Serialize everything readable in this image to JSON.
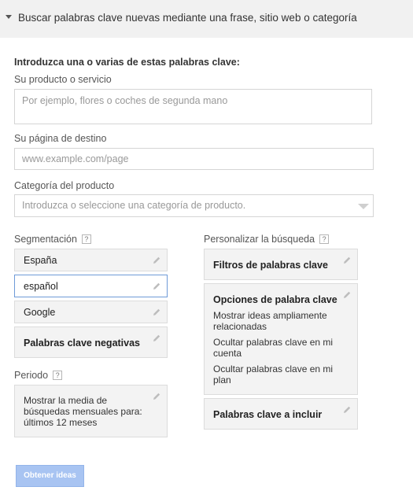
{
  "header": {
    "title": "Buscar palabras clave nuevas mediante una frase, sitio web o categoría"
  },
  "intro": "Introduzca una o varias de estas palabras clave:",
  "product": {
    "label": "Su producto o servicio",
    "placeholder": "Por ejemplo, flores o coches de segunda mano"
  },
  "landing": {
    "label": "Su página de destino",
    "placeholder": "www.example.com/page"
  },
  "category": {
    "label": "Categoría del producto",
    "placeholder": "Introduzca o seleccione una categoría de producto."
  },
  "targeting": {
    "label": "Segmentación",
    "help": "?",
    "items": [
      "España",
      "español",
      "Google"
    ],
    "negative": "Palabras clave negativas"
  },
  "period": {
    "label": "Periodo",
    "help": "?",
    "lines": [
      "Mostrar la media de",
      "búsquedas mensuales para:",
      "últimos 12 meses"
    ]
  },
  "customize": {
    "label": "Personalizar la búsqueda",
    "help": "?",
    "filters": "Filtros de palabras clave",
    "options": {
      "title": "Opciones de palabra clave",
      "lines": [
        [
          "Mostrar ideas ampliamente",
          "relacionadas"
        ],
        [
          "Ocultar palabras clave en mi",
          "cuenta"
        ],
        [
          "Ocultar palabras clave en mi",
          "plan"
        ]
      ]
    },
    "include": "Palabras clave a incluir"
  },
  "submit": "Obtener ideas"
}
